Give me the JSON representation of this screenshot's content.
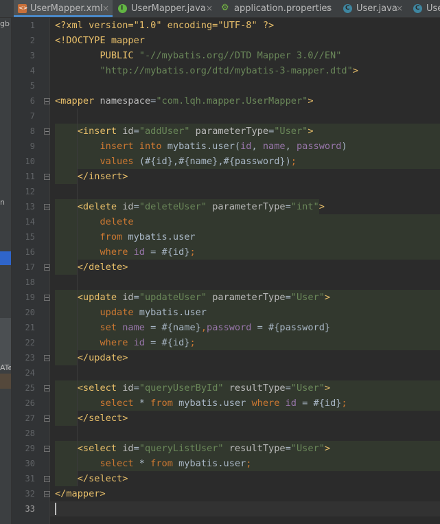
{
  "tabs": [
    {
      "label": "UserMapper.xml",
      "icon": "xml-file-icon",
      "active": true
    },
    {
      "label": "UserMapper.java",
      "icon": "interface-icon",
      "active": false
    },
    {
      "label": "application.properties",
      "icon": "properties-file-icon",
      "active": false
    },
    {
      "label": "User.java",
      "icon": "class-icon",
      "active": false
    },
    {
      "label": "User",
      "icon": "class-icon",
      "active": false
    }
  ],
  "tab_close_glyph": "×",
  "left_panel_fragments": [
    "gb",
    "n",
    "ATe"
  ],
  "code_lines": [
    [
      [
        "t-doc",
        "<?xml version=\"1.0\" encoding=\"UTF-8\" ?>"
      ]
    ],
    [
      [
        "t-doc",
        "<!DOCTYPE mapper"
      ]
    ],
    [
      [
        "t-plain",
        "        "
      ],
      [
        "t-doc",
        "PUBLIC "
      ],
      [
        "t-str",
        "\"-//mybatis.org//DTD Mapper 3.0//EN\""
      ]
    ],
    [
      [
        "t-plain",
        "        "
      ],
      [
        "t-str",
        "\"http://mybatis.org/dtd/mybatis-3-mapper.dtd\""
      ],
      [
        "t-doc",
        ">"
      ]
    ],
    [],
    [
      [
        "t-tag",
        "<mapper "
      ],
      [
        "t-attr",
        "namespace"
      ],
      [
        "t-plain",
        "="
      ],
      [
        "t-str",
        "\"com.lqh.mapper.UserMapper\""
      ],
      [
        "t-tag",
        ">"
      ]
    ],
    [],
    [
      [
        "t-plain",
        "    "
      ],
      [
        "t-tag",
        "<insert "
      ],
      [
        "t-attr",
        "id"
      ],
      [
        "t-plain",
        "="
      ],
      [
        "t-str",
        "\"addUser\""
      ],
      [
        "t-plain",
        " "
      ],
      [
        "t-attr",
        "parameterType"
      ],
      [
        "t-plain",
        "="
      ],
      [
        "t-str",
        "\"User\""
      ],
      [
        "t-tag",
        ">"
      ]
    ],
    [
      [
        "t-plain",
        "        "
      ],
      [
        "t-kw",
        "insert into "
      ],
      [
        "t-plain",
        "mybatis.user("
      ],
      [
        "t-id",
        "id"
      ],
      [
        "t-plain",
        ", "
      ],
      [
        "t-id",
        "name"
      ],
      [
        "t-plain",
        ", "
      ],
      [
        "t-id",
        "password"
      ],
      [
        "t-plain",
        ")"
      ]
    ],
    [
      [
        "t-plain",
        "        "
      ],
      [
        "t-kw",
        "values "
      ],
      [
        "t-plain",
        "(#{id},#{name},#{password})"
      ],
      [
        "t-kw",
        ";"
      ]
    ],
    [
      [
        "t-plain",
        "    "
      ],
      [
        "t-tag",
        "</insert>"
      ]
    ],
    [],
    [
      [
        "t-plain",
        "    "
      ],
      [
        "t-tag",
        "<delete "
      ],
      [
        "t-attr",
        "id"
      ],
      [
        "t-plain",
        "="
      ],
      [
        "t-str",
        "\"deleteUser\""
      ],
      [
        "t-plain",
        " "
      ],
      [
        "t-attr",
        "parameterType"
      ],
      [
        "t-plain",
        "="
      ],
      [
        "t-str",
        "\"int\""
      ],
      [
        "t-tag",
        ">"
      ]
    ],
    [
      [
        "t-plain",
        "        "
      ],
      [
        "t-kw",
        "delete"
      ]
    ],
    [
      [
        "t-plain",
        "        "
      ],
      [
        "t-kw",
        "from "
      ],
      [
        "t-plain",
        "mybatis.user"
      ]
    ],
    [
      [
        "t-plain",
        "        "
      ],
      [
        "t-kw",
        "where "
      ],
      [
        "t-id",
        "id"
      ],
      [
        "t-plain",
        " = #{id}"
      ],
      [
        "t-kw",
        ";"
      ]
    ],
    [
      [
        "t-plain",
        "    "
      ],
      [
        "t-tag",
        "</delete>"
      ]
    ],
    [],
    [
      [
        "t-plain",
        "    "
      ],
      [
        "t-tag",
        "<update "
      ],
      [
        "t-attr",
        "id"
      ],
      [
        "t-plain",
        "="
      ],
      [
        "t-str",
        "\"updateUser\""
      ],
      [
        "t-plain",
        " "
      ],
      [
        "t-attr",
        "parameterType"
      ],
      [
        "t-plain",
        "="
      ],
      [
        "t-str",
        "\"User\""
      ],
      [
        "t-tag",
        ">"
      ]
    ],
    [
      [
        "t-plain",
        "        "
      ],
      [
        "t-kw",
        "update "
      ],
      [
        "t-plain",
        "mybatis.user"
      ]
    ],
    [
      [
        "t-plain",
        "        "
      ],
      [
        "t-kw",
        "set "
      ],
      [
        "t-id",
        "name"
      ],
      [
        "t-plain",
        " = #{name}"
      ],
      [
        "t-kw",
        ","
      ],
      [
        "t-id",
        "password"
      ],
      [
        "t-plain",
        " = #{password}"
      ]
    ],
    [
      [
        "t-plain",
        "        "
      ],
      [
        "t-kw",
        "where "
      ],
      [
        "t-id",
        "id"
      ],
      [
        "t-plain",
        " = #{id}"
      ],
      [
        "t-kw",
        ";"
      ]
    ],
    [
      [
        "t-plain",
        "    "
      ],
      [
        "t-tag",
        "</update>"
      ]
    ],
    [],
    [
      [
        "t-plain",
        "    "
      ],
      [
        "t-tag",
        "<select "
      ],
      [
        "t-attr",
        "id"
      ],
      [
        "t-plain",
        "="
      ],
      [
        "t-str",
        "\"queryUserById\""
      ],
      [
        "t-plain",
        " "
      ],
      [
        "t-attr",
        "resultType"
      ],
      [
        "t-plain",
        "="
      ],
      [
        "t-str",
        "\"User\""
      ],
      [
        "t-tag",
        ">"
      ]
    ],
    [
      [
        "t-plain",
        "        "
      ],
      [
        "t-kw",
        "select "
      ],
      [
        "t-plain",
        "* "
      ],
      [
        "t-kw",
        "from "
      ],
      [
        "t-plain",
        "mybatis.user "
      ],
      [
        "t-kw",
        "where "
      ],
      [
        "t-id",
        "id"
      ],
      [
        "t-plain",
        " = #{id}"
      ],
      [
        "t-kw",
        ";"
      ]
    ],
    [
      [
        "t-plain",
        "    "
      ],
      [
        "t-tag",
        "</select>"
      ]
    ],
    [],
    [
      [
        "t-plain",
        "    "
      ],
      [
        "t-tag",
        "<select "
      ],
      [
        "t-attr",
        "id"
      ],
      [
        "t-plain",
        "="
      ],
      [
        "t-str",
        "\"queryListUser\""
      ],
      [
        "t-plain",
        " "
      ],
      [
        "t-attr",
        "resultType"
      ],
      [
        "t-plain",
        "="
      ],
      [
        "t-str",
        "\"User\""
      ],
      [
        "t-tag",
        ">"
      ]
    ],
    [
      [
        "t-plain",
        "        "
      ],
      [
        "t-kw",
        "select "
      ],
      [
        "t-plain",
        "* "
      ],
      [
        "t-kw",
        "from "
      ],
      [
        "t-plain",
        "mybatis.user"
      ],
      [
        "t-kw",
        ";"
      ]
    ],
    [
      [
        "t-plain",
        "    "
      ],
      [
        "t-tag",
        "</select>"
      ]
    ],
    [
      [
        "t-tag",
        "</mapper>"
      ]
    ],
    []
  ],
  "current_line": 33,
  "colors": {
    "editor_bg": "#2b2b2b",
    "gutter_bg": "#313335",
    "sql_fragment_bg": "#32382e",
    "xml_tag": "#e8bf6a",
    "attribute": "#bababa",
    "string": "#6a8759",
    "keyword": "#cc7832",
    "identifier": "#9876aa"
  }
}
